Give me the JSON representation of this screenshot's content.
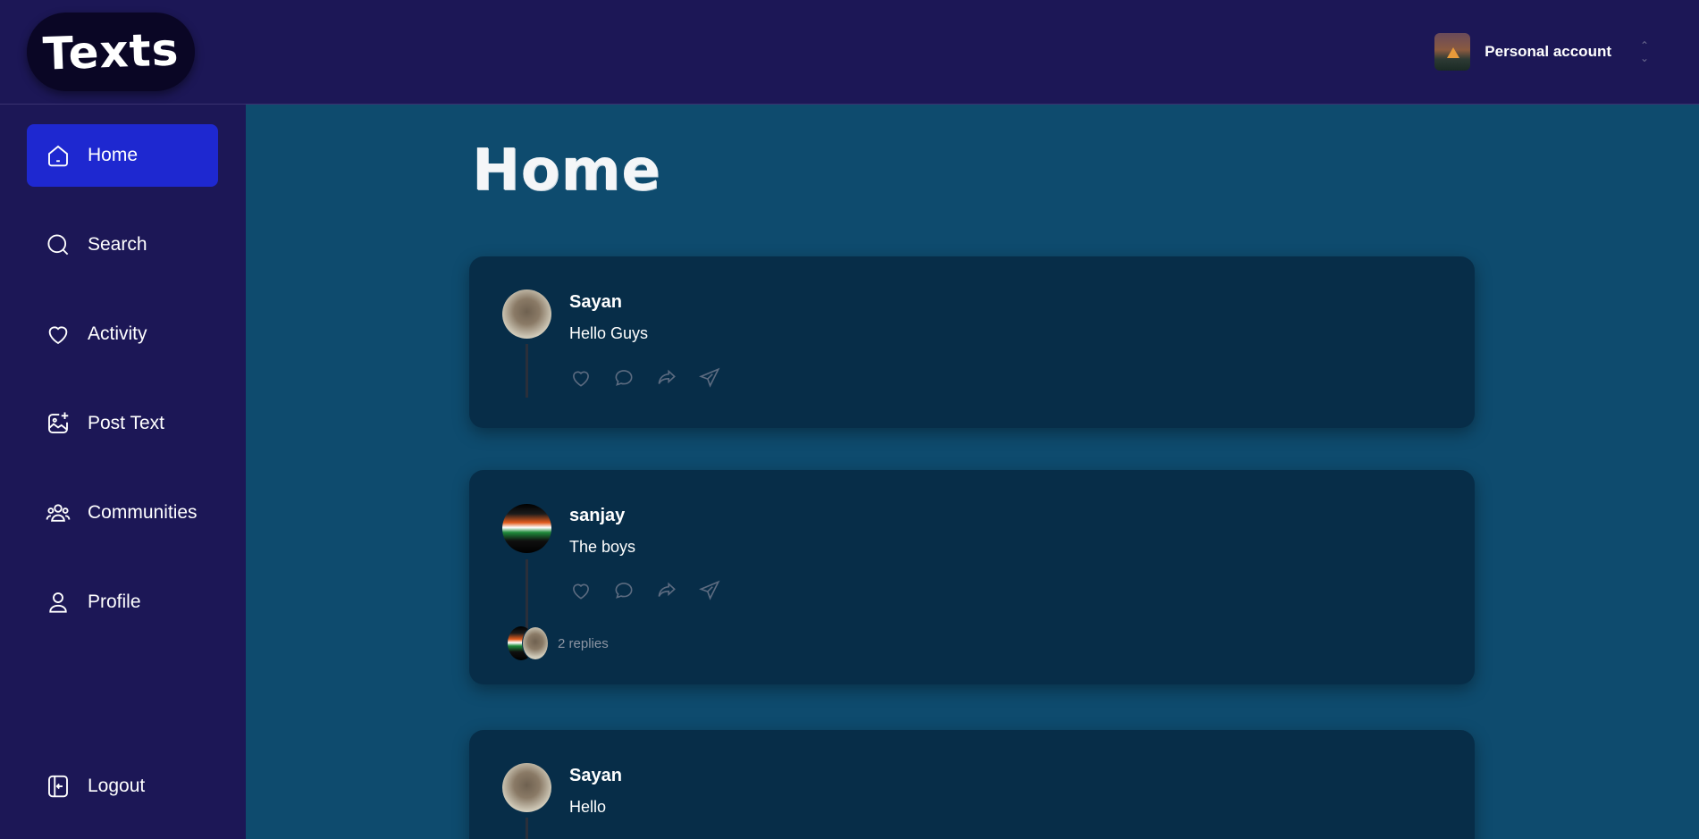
{
  "app": {
    "logo": "Texts"
  },
  "header": {
    "account_label": "Personal account",
    "account_icon": "user-avatar-campfire",
    "switch_icon": "chevron-up-down-icon"
  },
  "sidebar": {
    "items": [
      {
        "label": "Home",
        "icon": "home-icon",
        "active": true
      },
      {
        "label": "Search",
        "icon": "search-icon"
      },
      {
        "label": "Activity",
        "icon": "heart-icon"
      },
      {
        "label": "Post Text",
        "icon": "image-plus-icon"
      },
      {
        "label": "Communities",
        "icon": "users-icon"
      },
      {
        "label": "Profile",
        "icon": "user-icon"
      }
    ],
    "logout": {
      "label": "Logout",
      "icon": "logout-icon"
    }
  },
  "main": {
    "title": "Home",
    "posts": [
      {
        "author": "Sayan",
        "text": "Hello Guys"
      },
      {
        "author": "sanjay",
        "text": "The boys",
        "replies": "2 replies"
      },
      {
        "author": "Sayan",
        "text": "Hello"
      }
    ]
  },
  "colors": {
    "sidebar_bg": "#1c1756",
    "main_bg": "#0e4b6e",
    "card_bg": "#072d48",
    "active_nav": "#1e28d0",
    "action_icon": "#5c6b80"
  }
}
